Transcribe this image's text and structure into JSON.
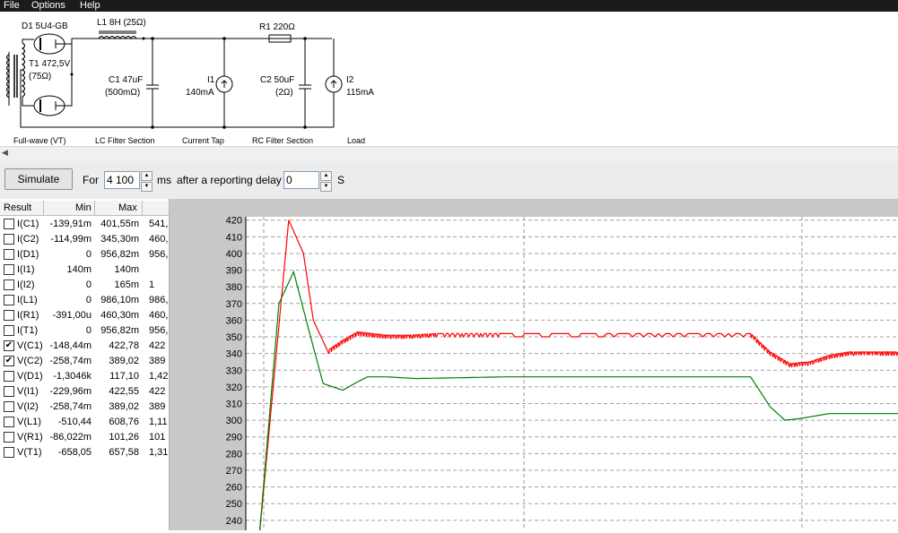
{
  "menu": [
    "File",
    "Options",
    "Help"
  ],
  "schematic": {
    "d1": "D1 5U4-GB",
    "t1_name": "T1 472,5V",
    "t1_res": "(75Ω)",
    "l1": "L1 8H (25Ω)",
    "r1": "R1 220Ω",
    "c1_name": "C1 47uF",
    "c1_esr": "(500mΩ)",
    "i1_name": "I1",
    "i1_val": "140mA",
    "c2_name": "C2 50uF",
    "c2_esr": "(2Ω)",
    "i2_name": "I2",
    "i2_val": "115mA",
    "sections": [
      "Full-wave (VT)",
      "LC Filter Section",
      "Current Tap",
      "RC Filter Section",
      "Load"
    ]
  },
  "sim": {
    "button": "Simulate",
    "for_label": "For",
    "duration": "4 100",
    "unit_ms": "ms",
    "delay_label": "after a reporting delay of",
    "delay": "0",
    "unit_s": "S"
  },
  "results": {
    "headers": [
      "Result",
      "Min",
      "Max"
    ],
    "rows": [
      {
        "name": "I(C1)",
        "min": "-139,91m",
        "max": "401,55m",
        "extra": "541,",
        "checked": false
      },
      {
        "name": "I(C2)",
        "min": "-114,99m",
        "max": "345,30m",
        "extra": "460,",
        "checked": false
      },
      {
        "name": "I(D1)",
        "min": "0",
        "max": "956,82m",
        "extra": "956,",
        "checked": false
      },
      {
        "name": "I(I1)",
        "min": "140m",
        "max": "140m",
        "extra": "",
        "checked": false
      },
      {
        "name": "I(I2)",
        "min": "0",
        "max": "165m",
        "extra": "1",
        "checked": false
      },
      {
        "name": "I(L1)",
        "min": "0",
        "max": "986,10m",
        "extra": "986,",
        "checked": false
      },
      {
        "name": "I(R1)",
        "min": "-391,00u",
        "max": "460,30m",
        "extra": "460,",
        "checked": false
      },
      {
        "name": "I(T1)",
        "min": "0",
        "max": "956,82m",
        "extra": "956,",
        "checked": false
      },
      {
        "name": "V(C1)",
        "min": "-148,44m",
        "max": "422,78",
        "extra": "422",
        "checked": true
      },
      {
        "name": "V(C2)",
        "min": "-258,74m",
        "max": "389,02",
        "extra": "389",
        "checked": true
      },
      {
        "name": "V(D1)",
        "min": "-1,3046k",
        "max": "117,10",
        "extra": "1,42",
        "checked": false
      },
      {
        "name": "V(I1)",
        "min": "-229,96m",
        "max": "422,55",
        "extra": "422",
        "checked": false
      },
      {
        "name": "V(I2)",
        "min": "-258,74m",
        "max": "389,02",
        "extra": "389",
        "checked": false
      },
      {
        "name": "V(L1)",
        "min": "-510,44",
        "max": "608,76",
        "extra": "1,11",
        "checked": false
      },
      {
        "name": "V(R1)",
        "min": "-86,022m",
        "max": "101,26",
        "extra": "101",
        "checked": false
      },
      {
        "name": "V(T1)",
        "min": "-658,05",
        "max": "657,58",
        "extra": "1,31",
        "checked": false
      }
    ]
  },
  "chart_data": {
    "type": "line",
    "y_ticks": [
      420,
      410,
      400,
      390,
      380,
      370,
      360,
      350,
      340,
      330,
      320,
      310,
      300,
      290,
      280,
      270,
      260,
      250,
      240
    ],
    "ylim": [
      234,
      422
    ],
    "grid": true,
    "series": [
      {
        "name": "V(C1)",
        "color": "#ff0000",
        "x": [
          0,
          0.3,
          0.45,
          0.55,
          0.7,
          0.85,
          1.0,
          1.15,
          1.3,
          1.5,
          1.8,
          2.5,
          3.5,
          5.0,
          5.2,
          5.4,
          5.6,
          5.8,
          6.0,
          6.3,
          6.5
        ],
        "y": [
          230,
          420,
          400,
          360,
          341,
          347,
          352,
          351,
          350,
          350,
          351,
          351,
          351,
          351,
          340,
          333,
          334,
          338,
          340,
          340,
          340
        ]
      },
      {
        "name": "V(C2)",
        "color": "#008000",
        "x": [
          0,
          0.2,
          0.35,
          0.5,
          0.65,
          0.85,
          1.0,
          1.1,
          1.3,
          1.6,
          2.5,
          3.5,
          5.0,
          5.2,
          5.35,
          5.5,
          5.8,
          6.2,
          6.5
        ],
        "y": [
          230,
          370,
          389,
          355,
          322,
          318,
          323,
          326,
          326,
          325,
          326,
          326,
          326,
          308,
          300,
          301,
          304,
          304,
          304
        ]
      }
    ],
    "ripple_series": "V(C1)"
  }
}
